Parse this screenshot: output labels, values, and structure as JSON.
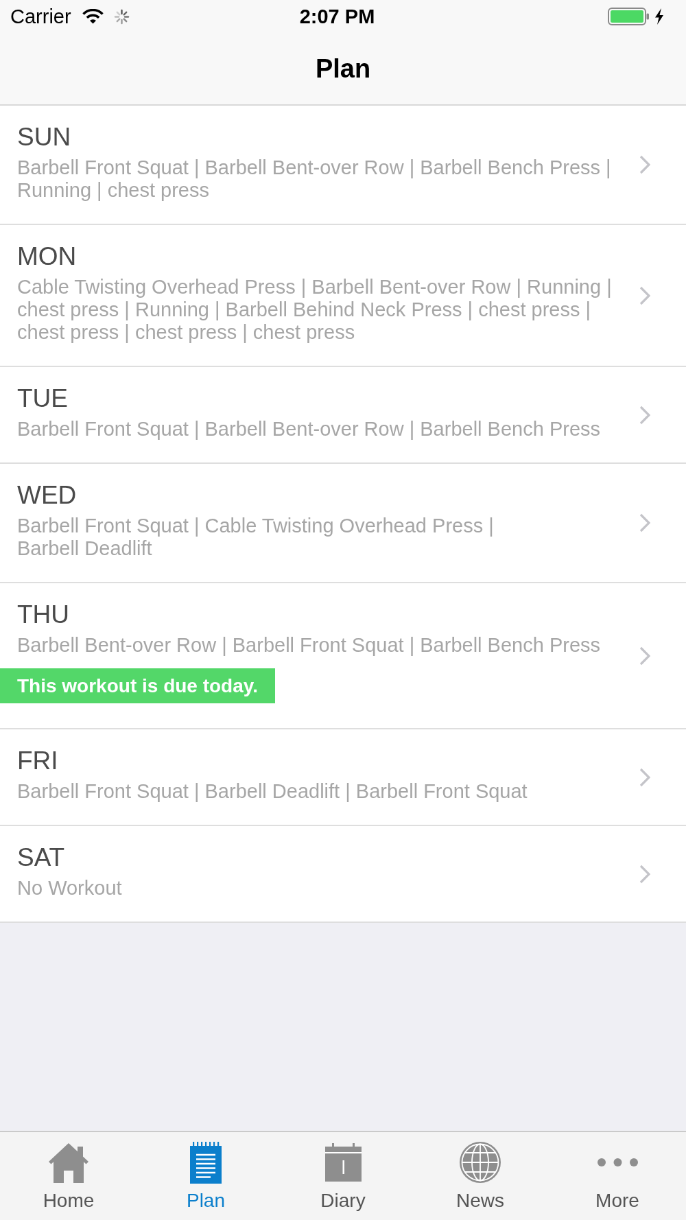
{
  "status_bar": {
    "carrier": "Carrier",
    "time": "2:07 PM"
  },
  "nav_bar": {
    "title": "Plan"
  },
  "days": [
    {
      "day": "SUN",
      "exercise_lines": [
        "Barbell Front Squat | Barbell Bent-over Row | Barbell Bench Press |",
        "Running | chest press"
      ]
    },
    {
      "day": "MON",
      "exercise_lines": [
        "Cable Twisting Overhead Press | Barbell Bent-over Row | Running |",
        "chest press | Running | Barbell Behind Neck Press | chest press |",
        "chest press | chest press | chest press"
      ]
    },
    {
      "day": "TUE",
      "exercise_lines": [
        "Barbell Front Squat | Barbell Bent-over Row | Barbell Bench Press"
      ]
    },
    {
      "day": "WED",
      "exercise_lines": [
        "Barbell Front Squat | Cable Twisting Overhead Press |",
        "Barbell Deadlift"
      ]
    },
    {
      "day": "THU",
      "exercise_lines": [
        "Barbell Bent-over Row | Barbell Front Squat | Barbell Bench Press"
      ],
      "notice": "This workout is due today."
    },
    {
      "day": "FRI",
      "exercise_lines": [
        "Barbell Front Squat | Barbell Deadlift | Barbell Front Squat"
      ]
    },
    {
      "day": "SAT",
      "exercise_lines": [
        "No Workout"
      ]
    }
  ],
  "tab_bar": {
    "tabs": [
      {
        "label": "Home",
        "selected": false
      },
      {
        "label": "Plan",
        "selected": true
      },
      {
        "label": "Diary",
        "selected": false
      },
      {
        "label": "News",
        "selected": false
      },
      {
        "label": "More",
        "selected": false
      }
    ]
  }
}
